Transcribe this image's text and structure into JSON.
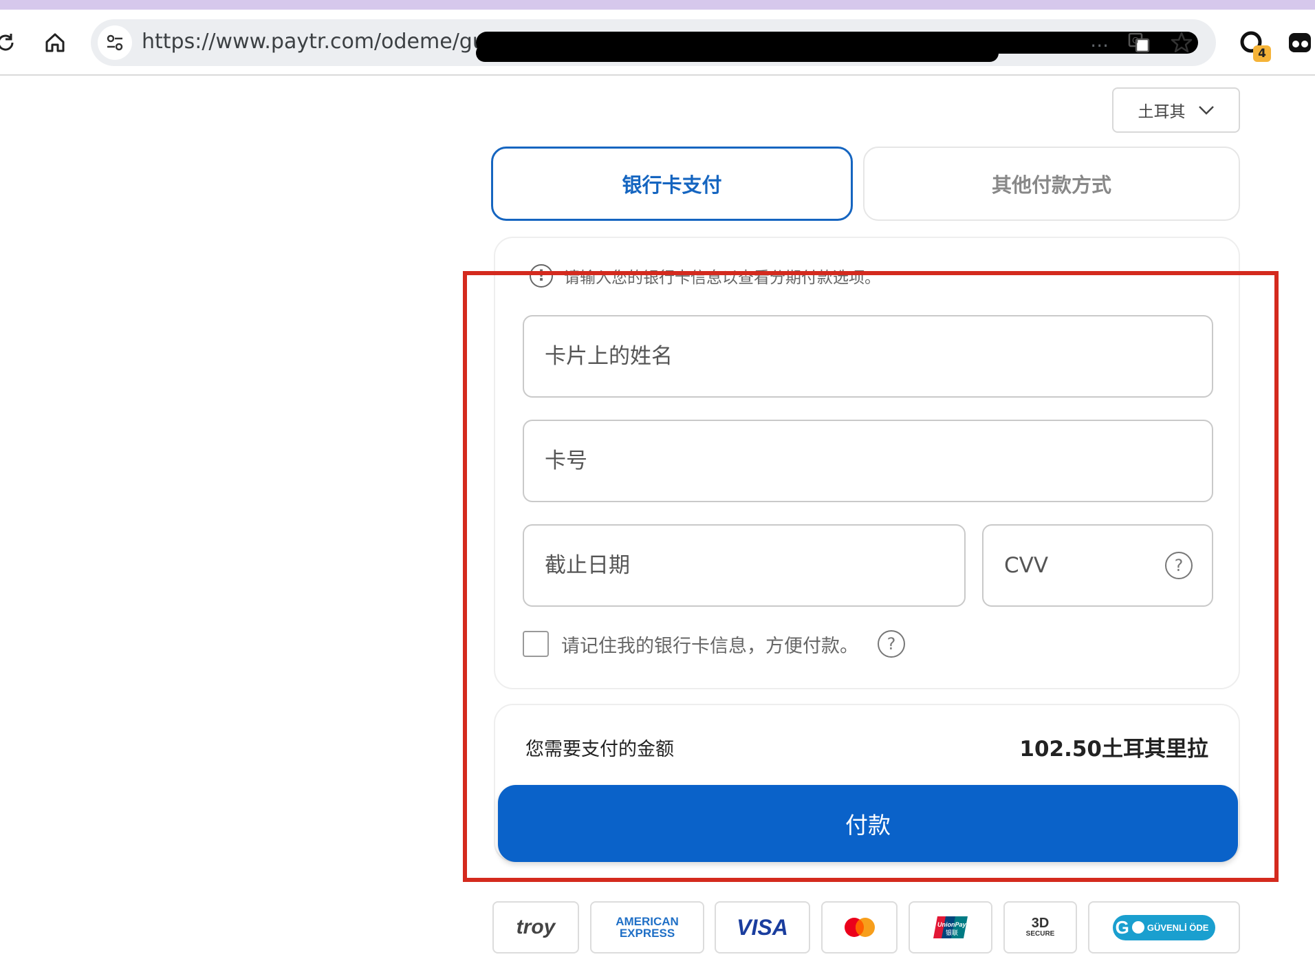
{
  "browser": {
    "url_visible": "https://www.paytr.com/odeme/guvenli",
    "url_ellipsis": "...",
    "extension_badge": "4",
    "icons": [
      "reload-icon",
      "home-icon",
      "site-settings-icon",
      "translate-icon",
      "bookmark-star-icon",
      "extension-icon",
      "profile-icon"
    ]
  },
  "language": {
    "selected": "土耳其"
  },
  "tabs": [
    {
      "label": "银行卡支付",
      "active": true
    },
    {
      "label": "其他付款方式",
      "active": false
    }
  ],
  "form": {
    "notice": "请输入您的银行卡信息以查看分期付款选项。",
    "name_placeholder": "卡片上的姓名",
    "number_placeholder": "卡号",
    "expiry_placeholder": "截止日期",
    "cvv_placeholder": "CVV",
    "remember_label": "请记住我的银行卡信息，方便付款。"
  },
  "payment": {
    "amount_label": "您需要支付的金额",
    "amount_value": "102.50土耳其里拉",
    "pay_button": "付款"
  },
  "logos": {
    "troy": "troy",
    "amex_line1": "AMERICAN",
    "amex_line2": "EXPRESS",
    "visa": "VISA",
    "unionpay_line1": "UnionPay",
    "unionpay_line2": "银联",
    "secure_3d_line1": "3D",
    "secure_3d_line2": "SECURE",
    "go_letter": "G",
    "go_text": "GÜVENLİ ÖDE"
  },
  "colors": {
    "accent_blue": "#1565c0",
    "pay_button": "#0a62c9",
    "highlight_red": "#d42a1e",
    "top_strip": "#d6c8ec"
  }
}
